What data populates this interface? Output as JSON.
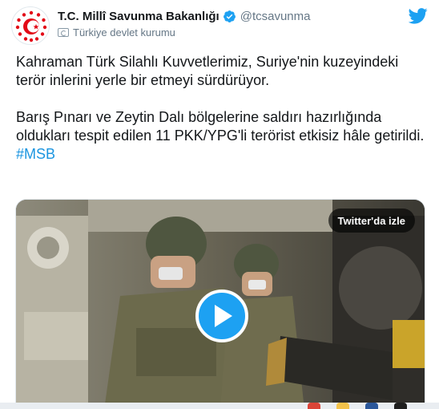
{
  "account": {
    "name": "T.C. Millî Savunma Bakanlığı",
    "handle": "@tcsavunma",
    "label": "Türkiye devlet kurumu"
  },
  "tweet": {
    "paragraph1": "Kahraman Türk Silahlı Kuvvetlerimiz, Suriye'nin kuzeyindeki terör inlerini yerle bir etmeyi sürdürüyor.",
    "paragraph2": "Barış Pınarı ve Zeytin Dalı bölgelerine saldırı hazırlığında oldukları tespit edilen 11 PKK/YPG'li terörist etkisiz hâle getirildi.",
    "hashtag": "#MSB"
  },
  "media": {
    "watch_label": "Twitter'da izle"
  },
  "icons": {
    "brand": "twitter-bird-icon",
    "verified": "verified-badge-icon",
    "government": "government-flag-icon",
    "play": "play-icon"
  },
  "colors": {
    "accent": "#1da1f2",
    "link": "#1b95e0",
    "muted": "#657786",
    "logo_red": "#e30a17"
  }
}
